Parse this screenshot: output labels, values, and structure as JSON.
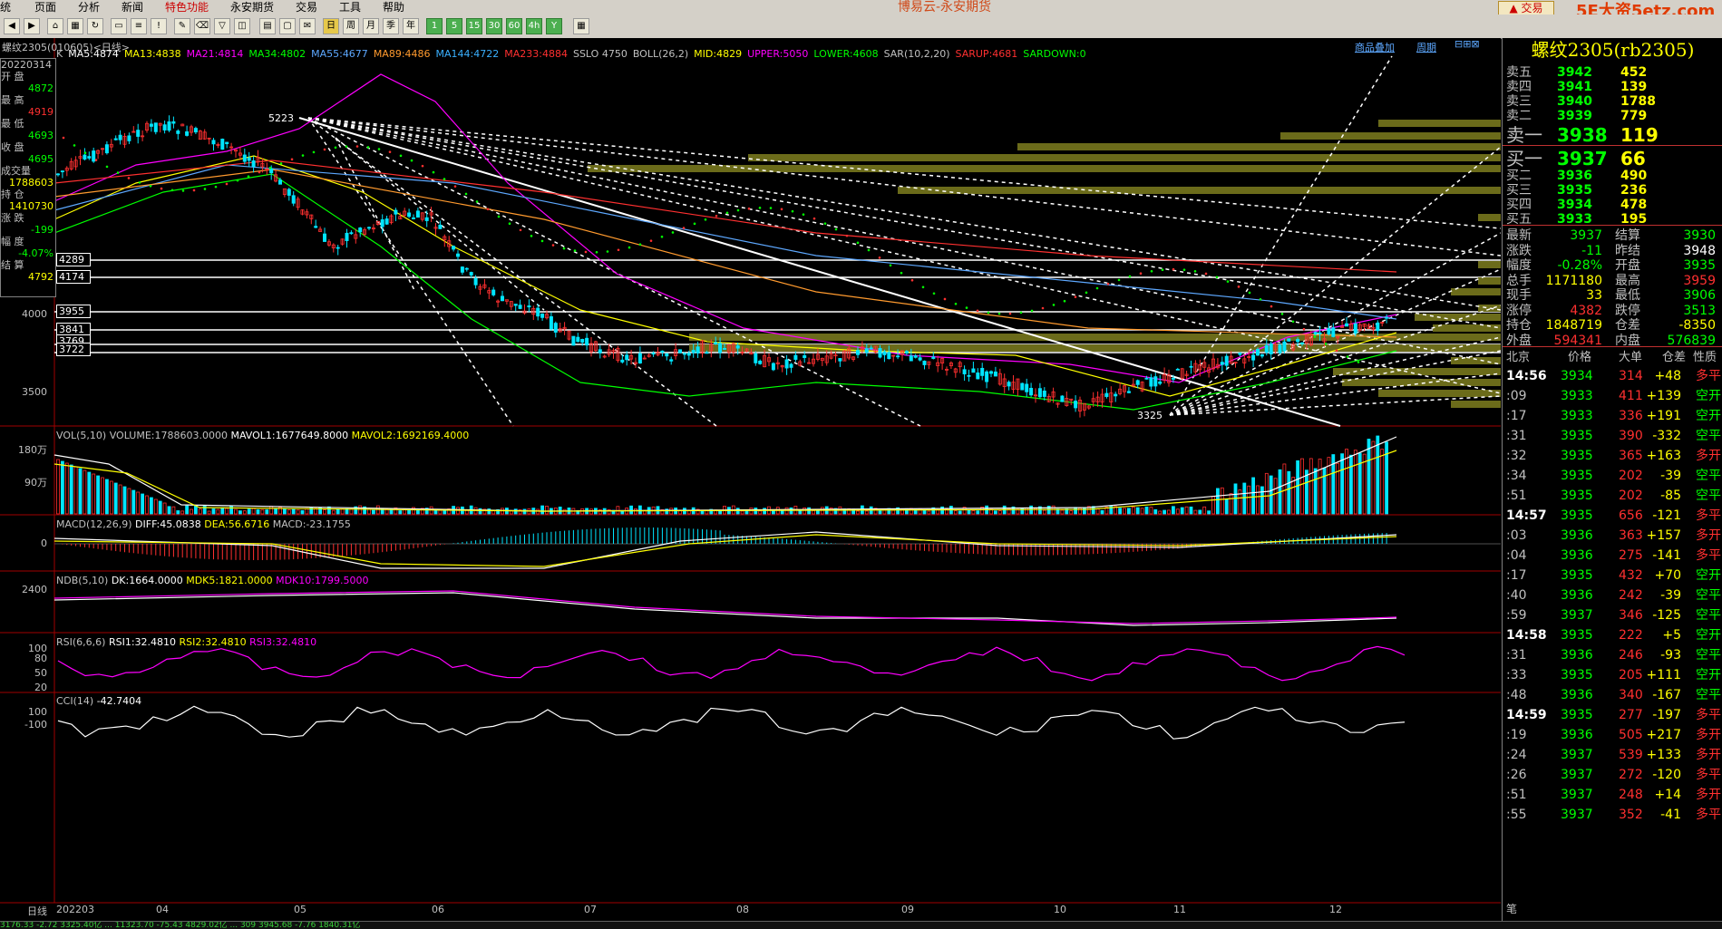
{
  "menu": [
    "统",
    "页面",
    "分析",
    "新闻",
    "特色功能",
    "永安期货",
    "交易",
    "工具",
    "帮助"
  ],
  "app_title": "博易云-永安期货",
  "trade_button": "交易",
  "brand_watermark": "5E大资5etz.com",
  "toolbar_periods": [
    "周",
    "月",
    "季",
    "年",
    "1",
    "5",
    "15",
    "30",
    "60",
    "4h",
    "Y"
  ],
  "chart_header": {
    "contract": "螺纹2305(010605)<日线>",
    "link_overlay": "商品叠加",
    "link_period": "周期"
  },
  "ma_legend": [
    {
      "t": "K",
      "c": "#c0c0c0"
    },
    {
      "t": "MA5:4874",
      "c": "#ffffff"
    },
    {
      "t": "MA13:4838",
      "c": "#ffff00"
    },
    {
      "t": "MA21:4814",
      "c": "#ff00ff"
    },
    {
      "t": "MA34:4802",
      "c": "#00ff00"
    },
    {
      "t": "MA55:4677",
      "c": "#5da8ff"
    },
    {
      "t": "MA89:4486",
      "c": "#ff9a2e"
    },
    {
      "t": "MA144:4722",
      "c": "#3ab0ff"
    },
    {
      "t": "MA233:4884",
      "c": "#ff3030"
    },
    {
      "t": "SSLO 4750",
      "c": "#c0c0c0"
    },
    {
      "t": "BOLL(26,2)",
      "c": "#c0c0c0"
    },
    {
      "t": "MID:4829",
      "c": "#ffff00"
    },
    {
      "t": "UPPER:5050",
      "c": "#ff00ff"
    },
    {
      "t": "LOWER:4608",
      "c": "#00ff00"
    },
    {
      "t": "SAR(10,2,20)",
      "c": "#c0c0c0"
    },
    {
      "t": "SARUP:4681",
      "c": "#ff3030"
    },
    {
      "t": "SARDOWN:0",
      "c": "#00ff00"
    }
  ],
  "left_box": [
    {
      "l": "20220314",
      "v": ""
    },
    {
      "l": "开  盘",
      "v": "4872"
    },
    {
      "l": "最  高",
      "v": "4919"
    },
    {
      "l": "最  低",
      "v": "4693"
    },
    {
      "l": "收  盘",
      "v": "4695"
    },
    {
      "l": "成交量",
      "v": "1788603"
    },
    {
      "l": "持  仓",
      "v": "1410730"
    },
    {
      "l": "涨  跌",
      "v": "-199"
    },
    {
      "l": "幅  度",
      "v": "-4.07%"
    },
    {
      "l": "结  算",
      "v": "4792"
    }
  ],
  "price_axis": [
    "4000",
    "3500"
  ],
  "box_labels": [
    "4289",
    "4174",
    "3955",
    "3841",
    "3769",
    "3722"
  ],
  "chart_annotations": {
    "high": "5223",
    "low": "3325"
  },
  "vol_legend": {
    "name": "VOL(5,10)",
    "volume": "VOLUME:1788603.0000",
    "mavol1": "MAVOL1:1677649.8000",
    "mavol2": "MAVOL2:1692169.4000"
  },
  "vol_axis": [
    "180万",
    "90万"
  ],
  "macd_legend": {
    "name": "MACD(12,26,9)",
    "diff": "DIFF:45.0838",
    "dea": "DEA:56.6716",
    "macd": "MACD:-23.1755"
  },
  "macd_axis": [
    "0"
  ],
  "ndb_legend": {
    "name": "NDB(5,10)",
    "dk": "DK:1664.0000",
    "mdk5": "MDK5:1821.0000",
    "mdk10": "MDK10:1799.5000"
  },
  "ndb_axis": [
    "2400"
  ],
  "rsi_legend": {
    "name": "RSI(6,6,6)",
    "rsi1": "RSI1:32.4810",
    "rsi2": "RSI2:32.4810",
    "rsi3": "RSI3:32.4810"
  },
  "rsi_axis": [
    "100",
    "80",
    "50",
    "20"
  ],
  "cci_legend": {
    "name": "CCI(14)",
    "val": "-42.7404"
  },
  "cci_axis": [
    "100",
    "-100"
  ],
  "x_axis": [
    "日线",
    "202203",
    "04",
    "05",
    "06",
    "07",
    "08",
    "09",
    "10",
    "11",
    "12"
  ],
  "right_panel": {
    "title": "螺纹2305(rb2305)",
    "asks": [
      {
        "l": "卖五",
        "p": "3942",
        "v": "452"
      },
      {
        "l": "卖四",
        "p": "3941",
        "v": "139"
      },
      {
        "l": "卖三",
        "p": "3940",
        "v": "1788"
      },
      {
        "l": "卖二",
        "p": "3939",
        "v": "779"
      },
      {
        "l": "卖一",
        "p": "3938",
        "v": "119"
      }
    ],
    "bids": [
      {
        "l": "买一",
        "p": "3937",
        "v": "66"
      },
      {
        "l": "买二",
        "p": "3936",
        "v": "490"
      },
      {
        "l": "买三",
        "p": "3935",
        "v": "236"
      },
      {
        "l": "买四",
        "p": "3934",
        "v": "478"
      },
      {
        "l": "买五",
        "p": "3933",
        "v": "195"
      }
    ],
    "quotes": [
      {
        "l1": "最新",
        "v1": "3937",
        "l2": "结算",
        "v2": "3930",
        "c1": "#00ff00",
        "c2": "#00ff00"
      },
      {
        "l1": "涨跌",
        "v1": "-11",
        "l2": "昨结",
        "v2": "3948",
        "c1": "#00ff00",
        "c2": "#ffffff"
      },
      {
        "l1": "幅度",
        "v1": "-0.28%",
        "l2": "开盘",
        "v2": "3935",
        "c1": "#00ff00",
        "c2": "#00ff00"
      },
      {
        "l1": "总手",
        "v1": "1171180",
        "l2": "最高",
        "v2": "3959",
        "c1": "#ffff00",
        "c2": "#ff3030"
      },
      {
        "l1": "现手",
        "v1": "33",
        "l2": "最低",
        "v2": "3906",
        "c1": "#ffff00",
        "c2": "#00ff00"
      },
      {
        "l1": "涨停",
        "v1": "4382",
        "l2": "跌停",
        "v2": "3513",
        "c1": "#ff3030",
        "c2": "#00ff00"
      },
      {
        "l1": "持仓",
        "v1": "1848719",
        "l2": "仓差",
        "v2": "-8350",
        "c1": "#ffff00",
        "c2": "#ffff00"
      },
      {
        "l1": "外盘",
        "v1": "594341",
        "l2": "内盘",
        "v2": "576839",
        "c1": "#ff3030",
        "c2": "#00ff00"
      }
    ],
    "ticks_header": {
      "time": "北京",
      "price": "价格",
      "vol": "大单",
      "oi": "仓差",
      "nature": "性质"
    },
    "ticks": [
      {
        "t": "14:56",
        "p": "3934",
        "v": "314",
        "d": "+48",
        "n": "多平",
        "nc": "#ff3030"
      },
      {
        "t": ":09",
        "p": "3933",
        "v": "411",
        "d": "+139",
        "n": "空开",
        "nc": "#00ff00"
      },
      {
        "t": ":17",
        "p": "3933",
        "v": "336",
        "d": "+191",
        "n": "空开",
        "nc": "#00ff00"
      },
      {
        "t": ":31",
        "p": "3935",
        "v": "390",
        "d": "-332",
        "n": "空平",
        "nc": "#00ff00"
      },
      {
        "t": ":32",
        "p": "3935",
        "v": "365",
        "d": "+163",
        "n": "多开",
        "nc": "#ff3030"
      },
      {
        "t": ":34",
        "p": "3935",
        "v": "202",
        "d": "-39",
        "n": "空平",
        "nc": "#00ff00"
      },
      {
        "t": ":51",
        "p": "3935",
        "v": "202",
        "d": "-85",
        "n": "空平",
        "nc": "#00ff00"
      },
      {
        "t": "14:57",
        "p": "3935",
        "v": "656",
        "d": "-121",
        "n": "多平",
        "nc": "#ff3030"
      },
      {
        "t": ":03",
        "p": "3936",
        "v": "363",
        "d": "+157",
        "n": "多开",
        "nc": "#ff3030"
      },
      {
        "t": ":04",
        "p": "3936",
        "v": "275",
        "d": "-141",
        "n": "多平",
        "nc": "#ff3030"
      },
      {
        "t": ":17",
        "p": "3935",
        "v": "432",
        "d": "+70",
        "n": "空开",
        "nc": "#00ff00"
      },
      {
        "t": ":40",
        "p": "3936",
        "v": "242",
        "d": "-39",
        "n": "空平",
        "nc": "#00ff00"
      },
      {
        "t": ":59",
        "p": "3937",
        "v": "346",
        "d": "-125",
        "n": "空平",
        "nc": "#00ff00"
      },
      {
        "t": "14:58",
        "p": "3935",
        "v": "222",
        "d": "+5",
        "n": "空开",
        "nc": "#00ff00"
      },
      {
        "t": ":31",
        "p": "3936",
        "v": "246",
        "d": "-93",
        "n": "空平",
        "nc": "#00ff00"
      },
      {
        "t": ":33",
        "p": "3935",
        "v": "205",
        "d": "+111",
        "n": "空开",
        "nc": "#00ff00"
      },
      {
        "t": ":48",
        "p": "3936",
        "v": "340",
        "d": "-167",
        "n": "空平",
        "nc": "#00ff00"
      },
      {
        "t": "14:59",
        "p": "3935",
        "v": "277",
        "d": "-197",
        "n": "多平",
        "nc": "#ff3030"
      },
      {
        "t": ":19",
        "p": "3936",
        "v": "505",
        "d": "+217",
        "n": "多开",
        "nc": "#ff3030"
      },
      {
        "t": ":24",
        "p": "3937",
        "v": "539",
        "d": "+133",
        "n": "多开",
        "nc": "#ff3030"
      },
      {
        "t": ":26",
        "p": "3937",
        "v": "272",
        "d": "-120",
        "n": "多平",
        "nc": "#ff3030"
      },
      {
        "t": ":51",
        "p": "3937",
        "v": "248",
        "d": "+14",
        "n": "多开",
        "nc": "#ff3030"
      },
      {
        "t": ":55",
        "p": "3937",
        "v": "352",
        "d": "-41",
        "n": "多平",
        "nc": "#ff3030"
      }
    ],
    "bottom_tab": "笔"
  },
  "status_bar": "3176.33  -2.72  3325.40亿  ...  11323.70  -75.43  4829.02亿  ...  309  3945.68  -7.76  1840.31亿"
}
